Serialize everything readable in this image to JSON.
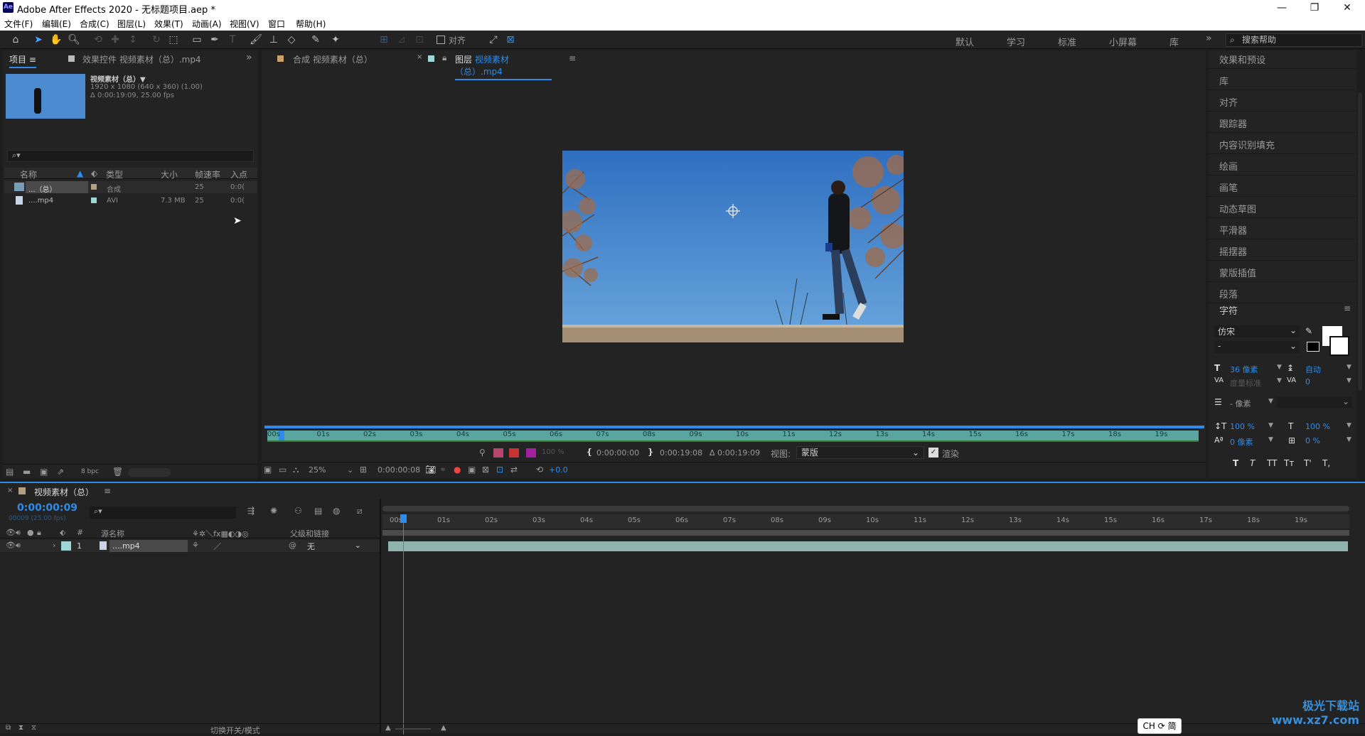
{
  "window": {
    "title": "Adobe After Effects 2020 - 无标题项目.aep *",
    "logo": "Ae",
    "controls": [
      "—",
      "❐",
      "✕"
    ]
  },
  "menu": [
    "文件(F)",
    "编辑(E)",
    "合成(C)",
    "图层(L)",
    "效果(T)",
    "动画(A)",
    "视图(V)",
    "窗口",
    "帮助(H)"
  ],
  "toolbar": {
    "align_label": "对齐",
    "workspaces": [
      "默认",
      "学习",
      "标准",
      "小屏幕",
      "库"
    ],
    "more": "»",
    "search_placeholder": "搜索帮助"
  },
  "project": {
    "tab_label": "项目",
    "effects_tab": "效果控件 视频素材（总）.mp4",
    "item_name": "视频素材（总）▼",
    "item_dims": "1920 x 1080 (640 x 360) (1.00)",
    "item_dur": "Δ 0:00:19:09, 25.00 fps",
    "search_placeholder": "⌕▾",
    "columns": [
      "名称",
      "类型",
      "大小",
      "帧速率",
      "入点"
    ],
    "rows": [
      {
        "name": "...（总）",
        "type": "合成",
        "size": "",
        "fps": "25",
        "in": "0:0("
      },
      {
        "name": "....mp4",
        "type": "AVI",
        "size": "7.3 MB",
        "fps": "25",
        "in": "0:0("
      }
    ],
    "bpc": "8 bpc"
  },
  "composition": {
    "comp_tab": "合成 视频素材（总）",
    "layer_tab_prefix": "图层",
    "layer_tab_name": "视频素材（总）.mp4",
    "ruler_labels": [
      "00s",
      "01s",
      "02s",
      "03s",
      "04s",
      "05s",
      "06s",
      "07s",
      "08s",
      "09s",
      "10s",
      "11s",
      "12s",
      "13s",
      "14s",
      "15s",
      "16s",
      "17s",
      "18s",
      "19s"
    ],
    "in_time": "0:00:00:00",
    "out_time": "0:00:19:08",
    "duration": "Δ 0:00:19:09",
    "view_label": "视图:",
    "view_value": "蒙版",
    "render_label": "渲染",
    "zoom": "25%",
    "current_time": "0:00:00:08",
    "exposure": "+0.0",
    "opacity": "100 %"
  },
  "right_panel": {
    "items": [
      "效果和预设",
      "库",
      "对齐",
      "跟踪器",
      "内容识别填充",
      "绘画",
      "画笔",
      "动态草图",
      "平滑器",
      "摇摆器",
      "蒙版插值",
      "段落"
    ],
    "char_title": "字符",
    "font_family": "仿宋",
    "font_style": "-",
    "font_size": "36 像素",
    "leading": "自动",
    "kerning": "度量标准",
    "tracking": "0",
    "stroke": "- 像素",
    "vscale": "100 %",
    "hscale": "100 %",
    "baseline": "0 像素",
    "tsume": "0 %",
    "text_buttons": [
      "T",
      "T",
      "TT",
      "Tт",
      "T'",
      "T,"
    ]
  },
  "timeline": {
    "tab_label": "视频素材（总）",
    "current_time": "0:00:00:09",
    "fps_info": "00009 (25.00 fps)",
    "search_placeholder": "⌕▾",
    "col_name": "源名称",
    "col_parent": "父级和链接",
    "layer_num": "1",
    "layer_name": "....mp4",
    "parent_value": "无",
    "ruler_labels": [
      "00s",
      "01s",
      "02s",
      "03s",
      "04s",
      "05s",
      "06s",
      "07s",
      "08s",
      "09s",
      "10s",
      "11s",
      "12s",
      "13s",
      "14s",
      "15s",
      "16s",
      "17s",
      "18s",
      "19s"
    ],
    "bottom_label": "切换开关/模式"
  },
  "ime_badge": "CH ⟳ 简",
  "watermark": "极光下载站\nwww.xz7.com",
  "colors": {
    "accent": "#2d8ceb",
    "sky": "#3f7fc6",
    "track": "#8fb3ad",
    "ruler": "#5aa5a0"
  }
}
